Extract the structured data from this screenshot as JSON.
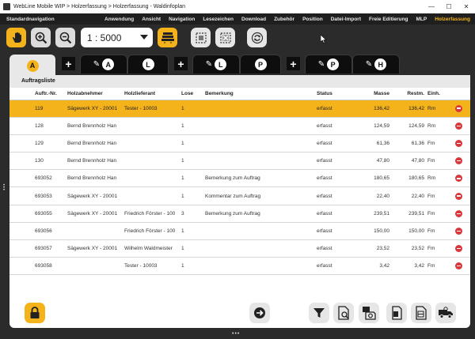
{
  "window": {
    "title": "WebLine Mobile WIP > Holzerfassung > Holzerfassung - Waldinfoplan",
    "controls": [
      "—",
      "☐",
      "✕"
    ]
  },
  "menubar": {
    "left_label": "Standardnavigation",
    "items": [
      "Anwendung",
      "Ansicht",
      "Navigation",
      "Lesezeichen",
      "Download",
      "Zubehör",
      "Position",
      "Datei-Import",
      "Freie Editierung",
      "MLP",
      "Holzerfassung"
    ],
    "active_index": 10
  },
  "toolbar": {
    "scale_value": "1 : 5000"
  },
  "tabs": [
    {
      "letter": "A",
      "pen": false,
      "active": true
    },
    {
      "letter": "A",
      "pen": true,
      "active": false
    },
    {
      "letter": "L",
      "pen": false,
      "active": false
    },
    {
      "letter": "L",
      "pen": true,
      "active": false
    },
    {
      "letter": "P",
      "pen": false,
      "active": false
    },
    {
      "letter": "P",
      "pen": true,
      "active": false
    },
    {
      "letter": "H",
      "pen": true,
      "active": false
    }
  ],
  "orders": {
    "title": "Auftragsliste",
    "columns": {
      "nr": "Auftr.-Nr.",
      "abnehmer": "Holzabnehmer",
      "lieferant": "Holzlieferant",
      "lose": "Lose",
      "bemerkung": "Bemerkung",
      "status": "Status",
      "masse": "Masse",
      "restm": "Restm.",
      "einh": "Einh."
    },
    "rows": [
      {
        "nr": "119",
        "abnehmer": "Sägewerk XY - 20001",
        "lieferant": "Tester - 10003",
        "lose": "1",
        "bemerkung": "",
        "status": "erfasst",
        "masse": "136,42",
        "restm": "136,42",
        "einh": "Rm",
        "selected": true
      },
      {
        "nr": "128",
        "abnehmer": "Bernd Brennholz Han",
        "lieferant": "",
        "lose": "1",
        "bemerkung": "",
        "status": "erfasst",
        "masse": "124,59",
        "restm": "124,59",
        "einh": "Rm",
        "selected": false
      },
      {
        "nr": "129",
        "abnehmer": "Bernd Brennholz Han",
        "lieferant": "",
        "lose": "1",
        "bemerkung": "",
        "status": "erfasst",
        "masse": "61,36",
        "restm": "61,36",
        "einh": "Fm",
        "selected": false
      },
      {
        "nr": "130",
        "abnehmer": "Bernd Brennholz Han",
        "lieferant": "",
        "lose": "1",
        "bemerkung": "",
        "status": "erfasst",
        "masse": "47,80",
        "restm": "47,80",
        "einh": "Fm",
        "selected": false
      },
      {
        "nr": "693052",
        "abnehmer": "Bernd Brennholz Han",
        "lieferant": "",
        "lose": "1",
        "bemerkung": "Bemerkung zum Auftrag",
        "status": "erfasst",
        "masse": "180,65",
        "restm": "180,65",
        "einh": "Rm",
        "selected": false
      },
      {
        "nr": "693053",
        "abnehmer": "Sägewerk XY - 20001",
        "lieferant": "",
        "lose": "1",
        "bemerkung": "Kommentar zum Auftrag",
        "status": "erfasst",
        "masse": "22,40",
        "restm": "22,40",
        "einh": "Fm",
        "selected": false
      },
      {
        "nr": "693055",
        "abnehmer": "Sägewerk XY - 20001",
        "lieferant": "Friedrich Förster - 100",
        "lose": "3",
        "bemerkung": "Bemerkung zum Auftrag",
        "status": "erfasst",
        "masse": "239,51",
        "restm": "239,51",
        "einh": "Fm",
        "selected": false
      },
      {
        "nr": "693056",
        "abnehmer": "",
        "lieferant": "Friedrich Förster - 100",
        "lose": "1",
        "bemerkung": "",
        "status": "erfasst",
        "masse": "150,00",
        "restm": "150,00",
        "einh": "Fm",
        "selected": false
      },
      {
        "nr": "693057",
        "abnehmer": "Sägewerk XY - 20001",
        "lieferant": "Wilhelm Waldmeister",
        "lose": "1",
        "bemerkung": "",
        "status": "erfasst",
        "masse": "23,52",
        "restm": "23,52",
        "einh": "Fm",
        "selected": false
      },
      {
        "nr": "693058",
        "abnehmer": "",
        "lieferant": "Tester - 10003",
        "lose": "1",
        "bemerkung": "",
        "status": "erfasst",
        "masse": "3,42",
        "restm": "3,42",
        "einh": "Fm",
        "selected": false
      }
    ]
  },
  "colors": {
    "accent": "#f5b31b",
    "dark_bg": "#2b2b2b",
    "delete": "#d9373c"
  },
  "icons": {
    "toolbar": [
      "hand-icon",
      "zoom-in-icon",
      "zoom-out-icon",
      "map-layers-icon",
      "select-area-icon",
      "clear-selection-icon",
      "refresh-icon"
    ],
    "bottom": [
      "lock-icon",
      "forward-icon",
      "filter-icon",
      "report-icon",
      "export-icon",
      "print-icon",
      "list-icon",
      "truck-icon"
    ]
  }
}
